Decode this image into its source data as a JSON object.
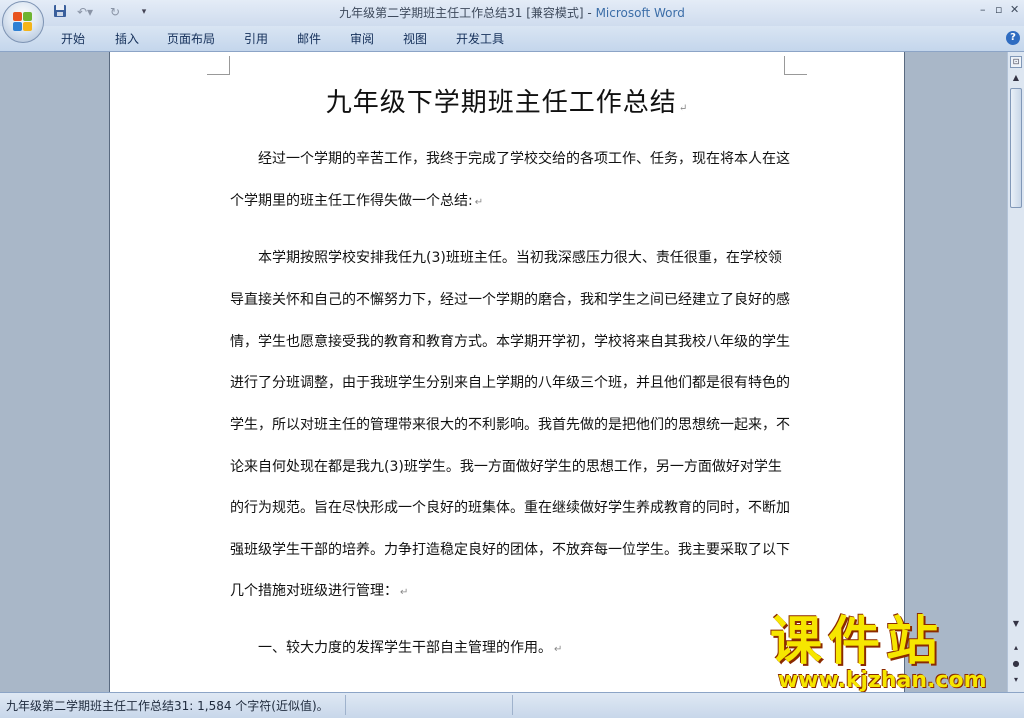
{
  "window": {
    "doc_name": "九年级第二学期班主任工作总结31 [兼容模式] - ",
    "app_name": "Microsoft Word"
  },
  "quick_access": {
    "save_icon": "save-icon",
    "undo_icon": "undo-icon",
    "redo_icon": "redo-icon"
  },
  "ribbon": {
    "tabs": [
      "开始",
      "插入",
      "页面布局",
      "引用",
      "邮件",
      "审阅",
      "视图",
      "开发工具"
    ]
  },
  "document": {
    "title": "九年级下学期班主任工作总结",
    "lines": [
      "经过一个学期的辛苦工作，我终于完成了学校交给的各项工作、任务，现在将本人在这",
      "个学期里的班主任工作得失做一个总结:",
      "本学期按照学校安排我任九(3)班班主任。当初我深感压力很大、责任很重，在学校领",
      "导直接关怀和自己的不懈努力下，经过一个学期的磨合，我和学生之间已经建立了良好的感",
      "情，学生也愿意接受我的教育和教育方式。本学期开学初，学校将来自其我校八年级的学生",
      "进行了分班调整，由于我班学生分别来自上学期的八年级三个班，并且他们都是很有特色的",
      "学生，所以对班主任的管理带来很大的不利影响。我首先做的是把他们的思想统一起来，不",
      "论来自何处现在都是我九(3)班学生。我一方面做好学生的思想工作，另一方面做好对学生",
      "的行为规范。旨在尽快形成一个良好的班集体。重在继续做好学生养成教育的同时，不断加",
      "强班级学生干部的培养。力争打造稳定良好的团体，不放弃每一位学生。我主要采取了以下",
      "几个措施对班级进行管理：",
      "一、较大力度的发挥学生干部自主管理的作用。"
    ]
  },
  "watermark": {
    "brand": "课件站",
    "url": "www.kjzhan.com"
  },
  "statusbar": {
    "text": "九年级第二学期班主任工作总结31: 1,584 个字符(近似值)。"
  }
}
